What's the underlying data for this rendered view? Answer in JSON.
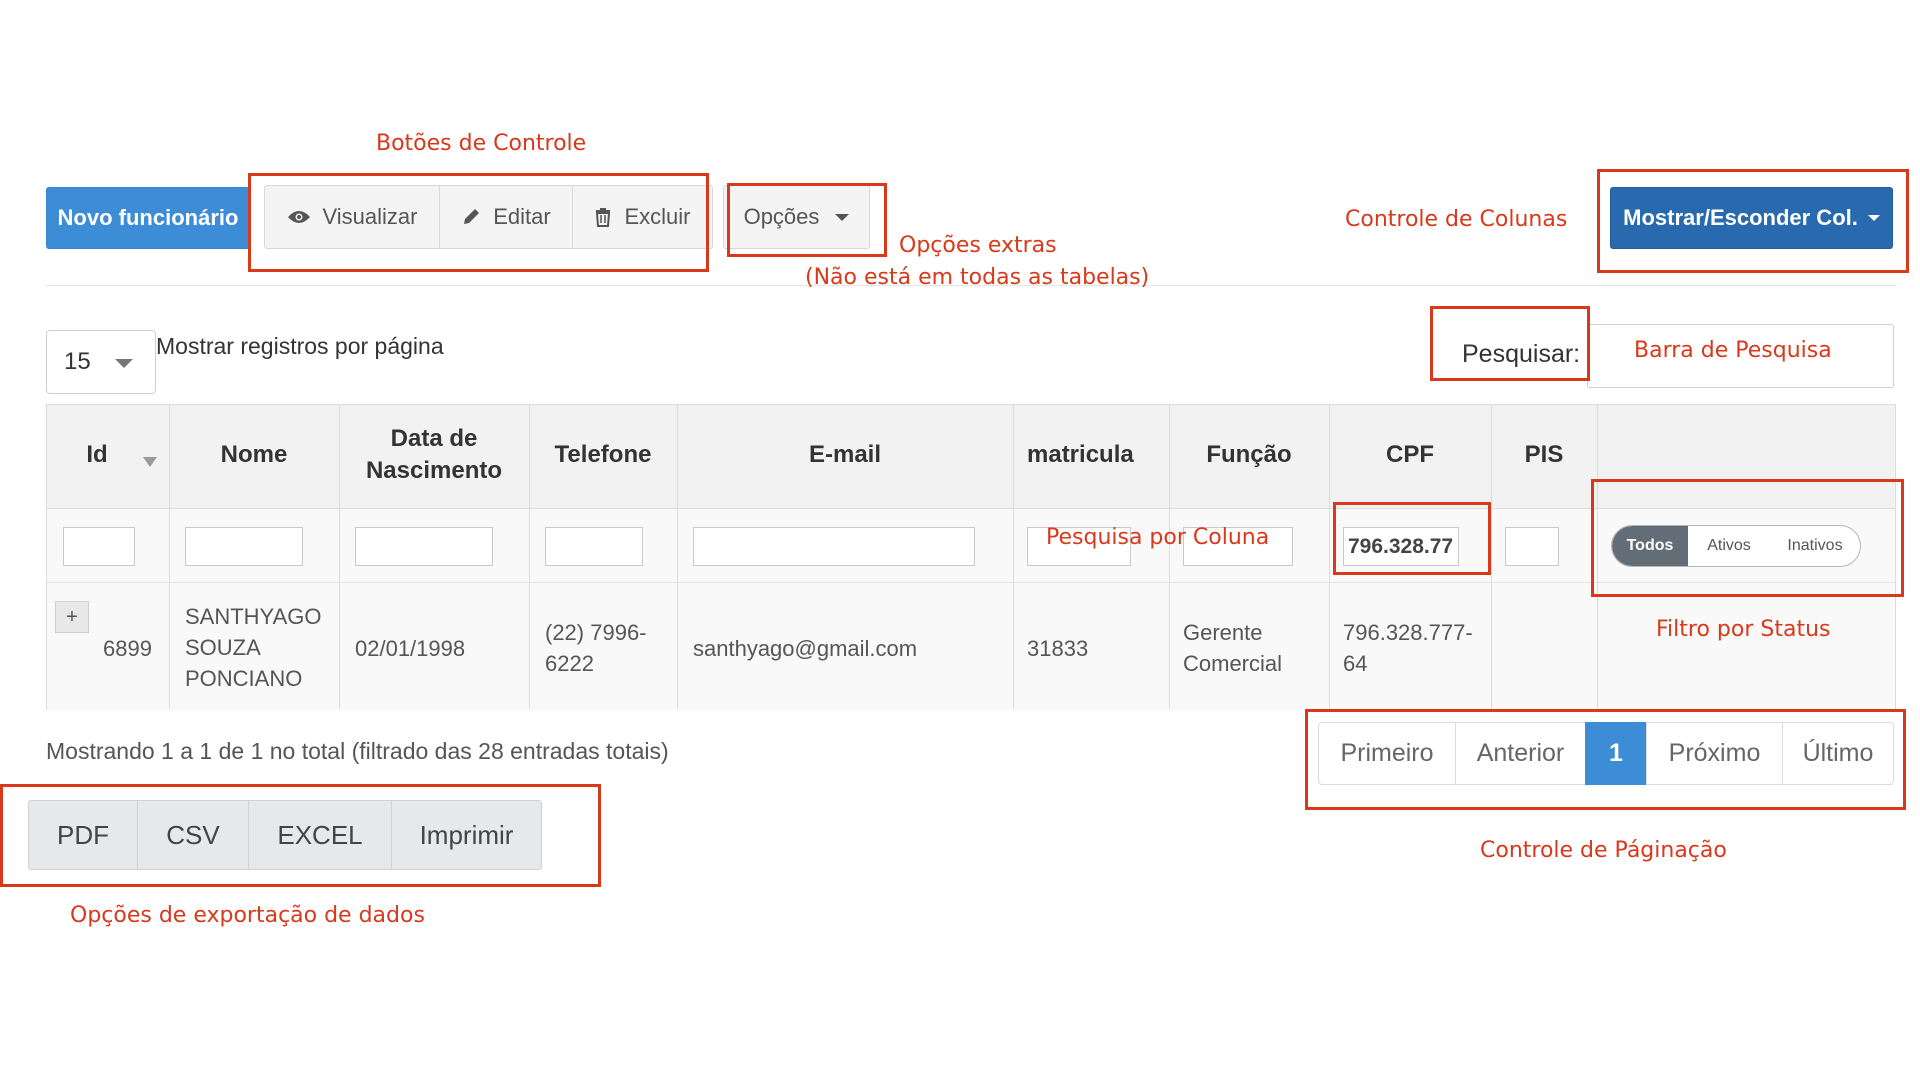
{
  "toolbar": {
    "new_employee": "Novo funcionário",
    "view": "Visualizar",
    "edit": "Editar",
    "delete": "Excluir",
    "options": "Opções",
    "columns_toggle": "Mostrar/Esconder Col."
  },
  "length": {
    "value": "15",
    "label": "Mostrar registros por página"
  },
  "search": {
    "label": "Pesquisar:"
  },
  "table": {
    "headers": [
      "Id",
      "Nome",
      "Data de Nascimento",
      "Telefone",
      "E-mail",
      "matricula",
      "Função",
      "CPF",
      "PIS"
    ],
    "cpf_filter_value": "796.328.77",
    "status_filter": [
      "Todos",
      "Ativos",
      "Inativos"
    ],
    "rows": [
      {
        "expand": "+",
        "id": "6899",
        "nome_l1": "SANTHYAGO",
        "nome_l2": "SOUZA",
        "nome_l3": "PONCIANO",
        "nascimento": "02/01/1998",
        "telefone_l1": "(22) 7996-",
        "telefone_l2": "6222",
        "email": "santhyago@gmail.com",
        "matricula": "31833",
        "funcao_l1": "Gerente",
        "funcao_l2": "Comercial",
        "cpf_l1": "796.328.777-",
        "cpf_l2": "64",
        "pis": ""
      }
    ]
  },
  "info": "Mostrando 1 a 1 de 1 no total (filtrado das 28 entradas totais)",
  "export": [
    "PDF",
    "CSV",
    "EXCEL",
    "Imprimir"
  ],
  "pagination": {
    "first": "Primeiro",
    "previous": "Anterior",
    "current": "1",
    "next": "Próximo",
    "last": "Último"
  },
  "annotations": {
    "control_buttons": "Botões de Controle",
    "extra_options_l1": "Opções extras",
    "extra_options_l2": "(Não está em todas as tabelas)",
    "column_control": "Controle de Colunas",
    "search_bar": "Barra de Pesquisa",
    "column_search": "Pesquisa por Coluna",
    "status_filter": "Filtro por Status",
    "pagination_control": "Controle de Páginação",
    "export_options": "Opções de exportação de dados"
  },
  "colors": {
    "annotation_red": "#d9391b",
    "primary_blue": "#3c8dd6",
    "dark_blue": "#286aad",
    "toggle_active": "#636d77"
  }
}
